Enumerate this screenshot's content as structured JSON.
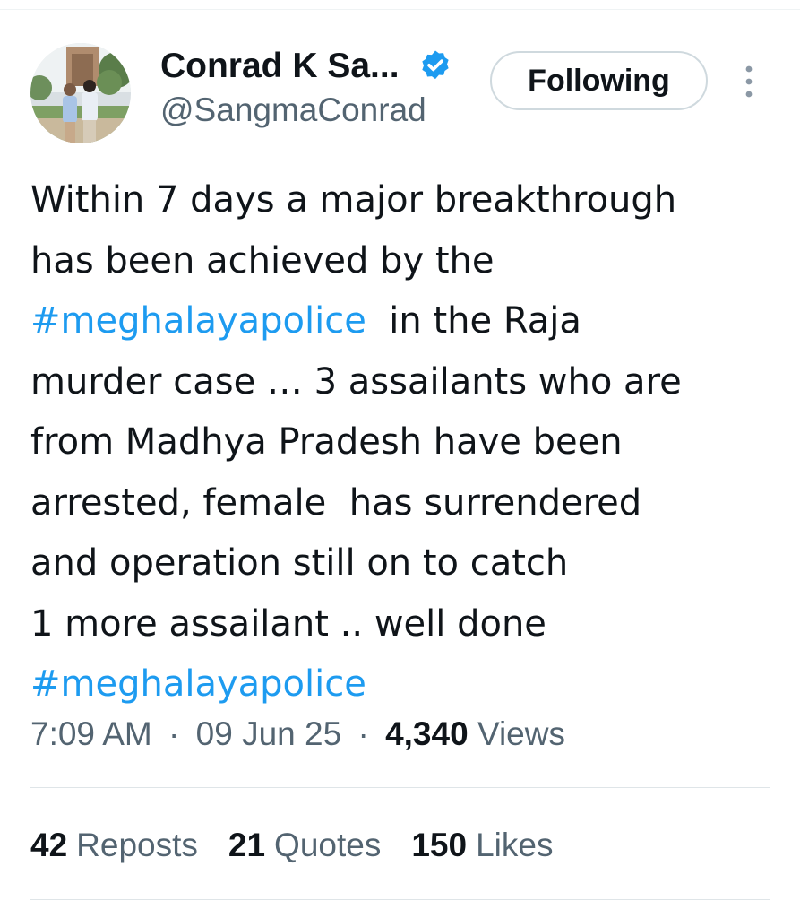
{
  "author": {
    "display_name": "Conrad K Sa...",
    "handle": "@SangmaConrad",
    "verified_icon": "verified-badge-icon",
    "avatar_icon": "profile-photo"
  },
  "actions": {
    "follow_label": "Following",
    "more_icon": "more-vertical-icon"
  },
  "tweet": {
    "lines": [
      [
        {
          "text": "Within 7 days a major breakthrough"
        }
      ],
      [
        {
          "text": "has been achieved by the"
        }
      ],
      [
        {
          "text": "#meghalayapolice",
          "hashtag": true
        },
        {
          "text": "  in the Raja"
        }
      ],
      [
        {
          "text": "murder case … 3 assailants who are"
        }
      ],
      [
        {
          "text": "from Madhya Pradesh have been"
        }
      ],
      [
        {
          "text": "arrested, female  has surrendered"
        }
      ],
      [
        {
          "text": "and operation still on to catch"
        }
      ],
      [
        {
          "text": "1 more assailant .. well done"
        }
      ],
      [
        {
          "text": "#meghalayapolice",
          "hashtag": true
        }
      ]
    ]
  },
  "meta": {
    "time": "7:09 AM",
    "separator": "·",
    "date": "09 Jun 25",
    "views_count": "4,340",
    "views_label": "Views"
  },
  "stats": {
    "reposts_count": "42",
    "reposts_label": "Reposts",
    "quotes_count": "21",
    "quotes_label": "Quotes",
    "likes_count": "150",
    "likes_label": "Likes"
  },
  "colors": {
    "link": "#1d9bf0",
    "text": "#0f1419",
    "secondary": "#536471",
    "verified": "#1d9bf0"
  }
}
